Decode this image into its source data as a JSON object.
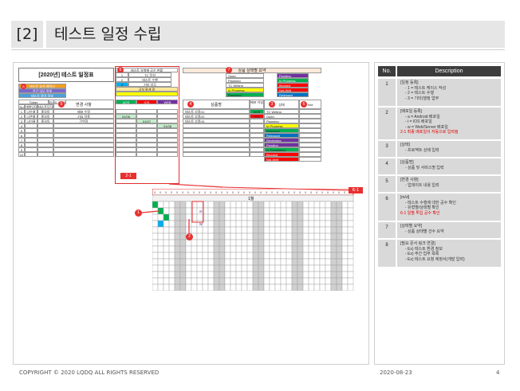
{
  "slide": {
    "section_number": "[2]",
    "title": "테스트 일정 수립",
    "footer_copyright": "COPYRIGHT © 2020 LQDQ ALL RIGHTS RESERVED",
    "footer_date": "2020-08-23",
    "footer_page": "4"
  },
  "table": {
    "col_no": "No.",
    "col_desc": "Description",
    "rows": [
      {
        "no": "1",
        "lines": [
          "[일정 등록]",
          "- 1 = 테스트 케이스 작성",
          "- 2 = 테스트 수행",
          "- 3 = 기타(행정 업무"
        ]
      },
      {
        "no": "2",
        "lines": [
          "[배포일 등록]",
          "- a = Android 배포일",
          "- i = IOS 배포일",
          "- w = Web/Server 배포일"
        ],
        "red": "2-1 최종 배포일이 자동으로 입력됨"
      },
      {
        "no": "3",
        "lines": [
          "[상태]",
          "- 프로젝트 상태 입력"
        ]
      },
      {
        "no": "4",
        "lines": [
          "[상품명]",
          "- 상품 및 서비스명 입력"
        ]
      },
      {
        "no": "5",
        "lines": [
          "[변경 사항]",
          "- 업데이트 내용 입력"
        ]
      },
      {
        "no": "6",
        "lines": [
          "[m/d]",
          "- 테스트 수행에 대한 공수 확인",
          "- 유형별/상태별 확인"
        ],
        "red": "6-1 일별 투입 공수 확인"
      },
      {
        "no": "7",
        "lines": [
          "[상태별 요약]",
          "- 상품 상태별 건수 요약"
        ]
      },
      {
        "no": "8",
        "lines": [
          "[필요 문서 링크 연결]",
          "- Ex) 테스트 환경 정보",
          "- Ex) 주간 업무 목록",
          "- Ex) 테스트 요청 에정서(개발 입력)"
        ]
      }
    ]
  },
  "sheet": {
    "title": "[2020년] 테스트 일정표",
    "summary_title": "테스트 유형별 공수 현황",
    "status_summary_title": "상품 상태별 요약",
    "doc_link": "테스트 요청 예정서",
    "doc_link2": "주간 업무 목록",
    "doc_link3": "테스트 환경 정보",
    "today_label": "Today",
    "today_value": "2020. 8. 23",
    "change_header": "변경 사항",
    "product_header": "상품명",
    "deploy_header": "배포 이일",
    "status_header": "상태",
    "md_header": "m/d",
    "col_no": "No",
    "col_dev": "개발담당",
    "col_qa": "테스트담당",
    "plan_1": "TC 작성",
    "plan_2": "테스트 수행",
    "plan_3": "기타 업무",
    "total_label": "공실 통계 합",
    "label_2_1": "2-1",
    "label_6_1": "6-1",
    "ios_label": "IOS",
    "and_label": "AOS",
    "web_label": "WEB",
    "rows": [
      {
        "no": "1",
        "dev": "나우쿨",
        "qa": "홍길동",
        "change": "배포 수정",
        "product": "테스트 상품(1)",
        "date": "01/06",
        "deploy": "AOS",
        "status": "TC Writing"
      },
      {
        "no": "2",
        "dev": "나쿠콜",
        "qa": "홍길동",
        "change": "기요 작풍",
        "product": "테스트 상품(2)",
        "date": "01/07",
        "deploy": "IOS",
        "status": "Open"
      },
      {
        "no": "3",
        "dev": "나이쿨",
        "qa": "홍길동",
        "change": "긴연장",
        "product": "테스트 상품(3)",
        "date": "01/08",
        "deploy": "",
        "status": "Planning"
      }
    ],
    "status_list": [
      {
        "name": "Open",
        "color": "#ffffff"
      },
      {
        "name": "Planning",
        "color": "#ffffff"
      },
      {
        "name": "TC Writing",
        "color": "#ffffff"
      },
      {
        "name": "In Progress",
        "color": "#ffff00"
      },
      {
        "name": "Resolved",
        "color": "#00b050"
      }
    ],
    "status_list2": [
      {
        "name": "Pending",
        "color": "#7030a0"
      },
      {
        "name": "In Progress",
        "color": "#00b050"
      },
      {
        "name": "Blocked",
        "color": "#ff0000"
      },
      {
        "name": "Not-Well",
        "color": "#ff0000"
      },
      {
        "name": "Released",
        "color": "#0070c0"
      }
    ],
    "status_col": [
      {
        "name": "TC Writing",
        "color": "#ffffff"
      },
      {
        "name": "Open",
        "color": "#ffffff"
      },
      {
        "name": "Planning",
        "color": "#ffffff"
      },
      {
        "name": "In Progress",
        "color": "#ffff00"
      },
      {
        "name": "Resolved",
        "color": "#00b050"
      },
      {
        "name": "Released",
        "color": "#0070c0"
      },
      {
        "name": "Reviewing",
        "color": "#7030a0"
      },
      {
        "name": "Pending",
        "color": "#7030a0"
      },
      {
        "name": "In Completed",
        "color": "#00b050"
      },
      {
        "name": "Blocked",
        "color": "#ff0000"
      },
      {
        "name": "Not-Well",
        "color": "#ff0000"
      }
    ],
    "grid_month": "1월",
    "grid_letter_a": "a",
    "grid_letter_w": "w"
  },
  "colors": {
    "accent_red": "#e83030",
    "header_dark": "#3c3c3c",
    "row_gray": "#d9d9d9",
    "green": "#00b050"
  }
}
